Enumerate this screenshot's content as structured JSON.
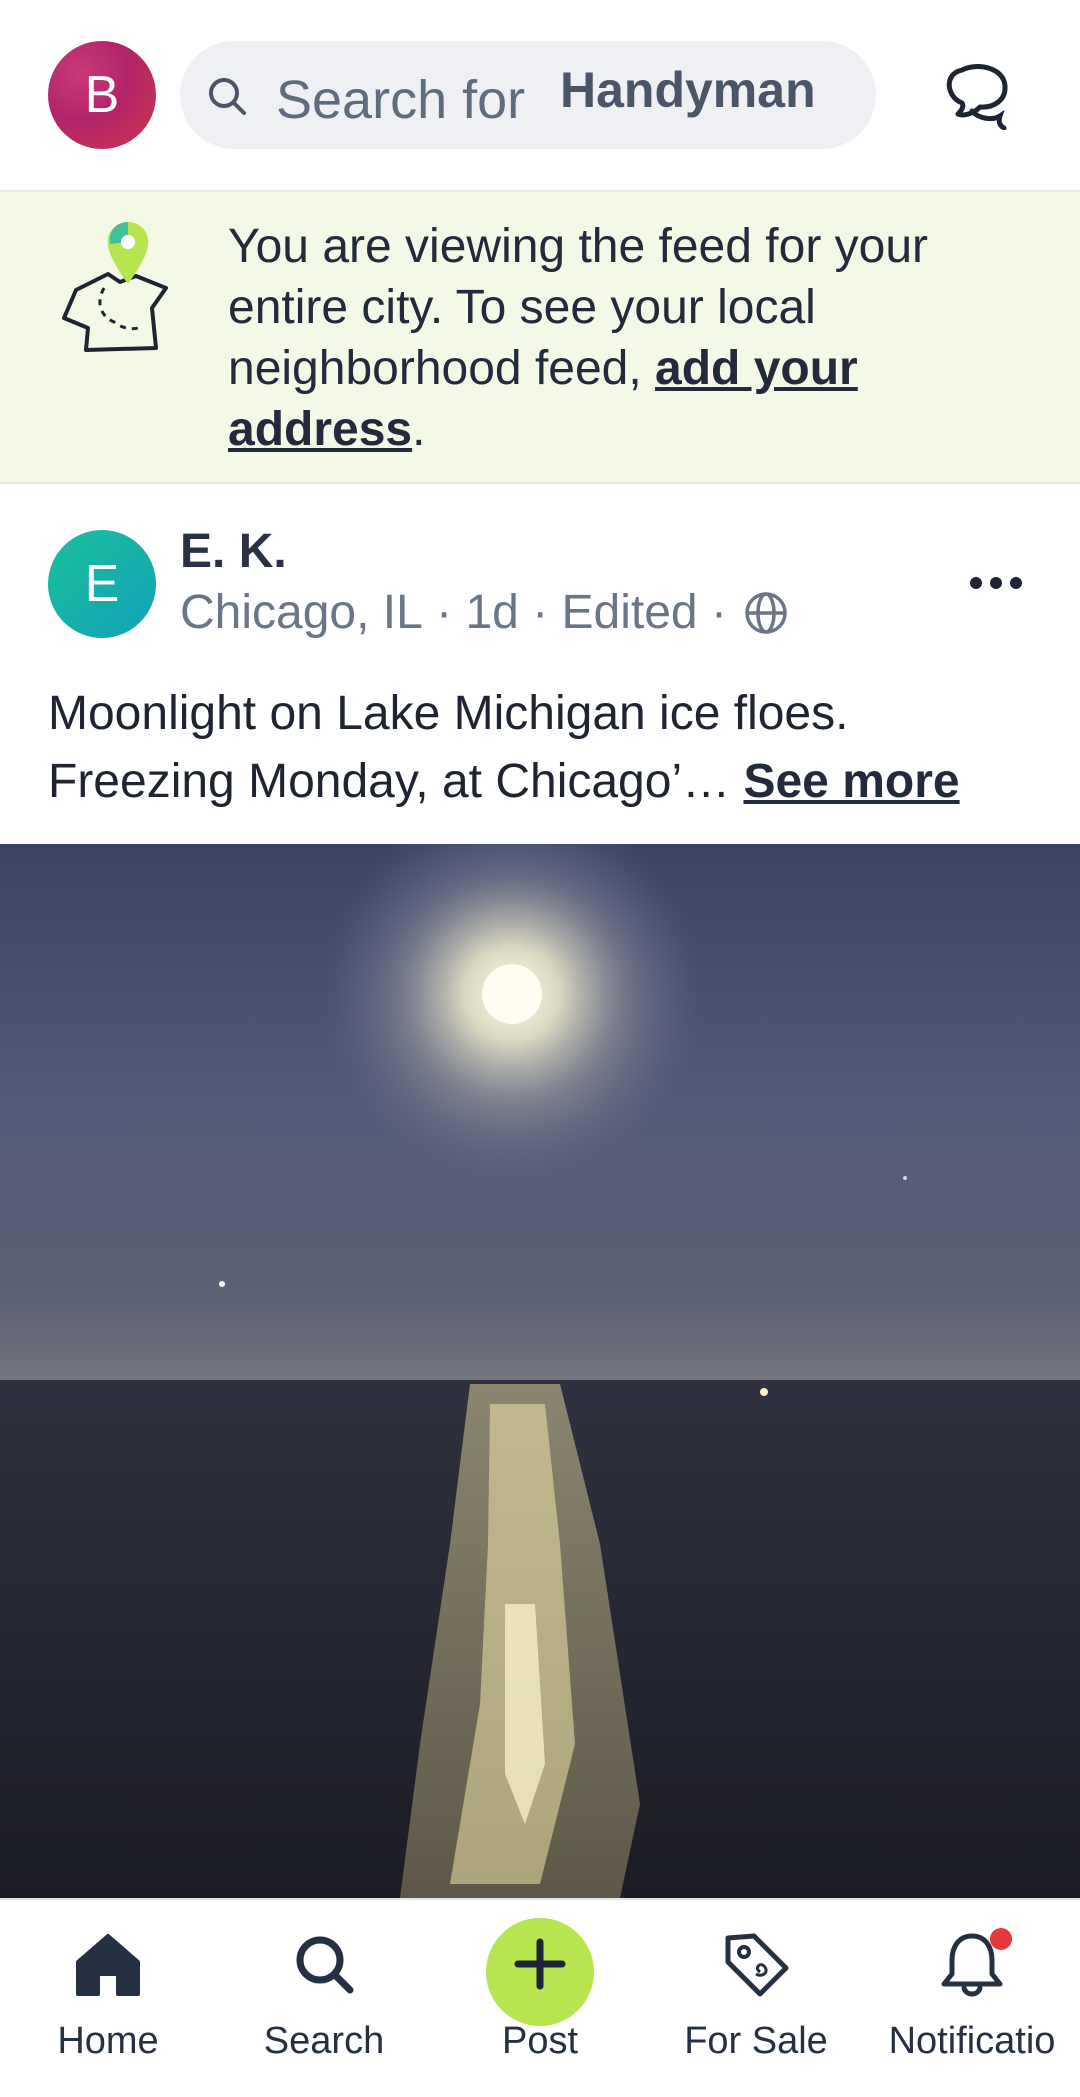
{
  "header": {
    "avatar_letter": "B",
    "search": {
      "placeholder": "Search for",
      "suggestion": "Handyman"
    }
  },
  "banner": {
    "text_before": "You are viewing the feed for your entire city. To see your local neighborhood feed, ",
    "link_text": "add your address",
    "text_after": "."
  },
  "post": {
    "avatar_letter": "E",
    "author": "E. K.",
    "location": "Chicago, IL",
    "time": "1d",
    "edited": "Edited",
    "body": "Moonlight on Lake Michigan ice floes. Freezing Monday, at Chicago’…",
    "see_more": "See more"
  },
  "bottom_nav": {
    "home": "Home",
    "search": "Search",
    "post": "Post",
    "for_sale": "For Sale",
    "notifications": "Notificatio"
  },
  "colors": {
    "accent_green": "#b6e54f",
    "banner_bg": "#f3f9e6",
    "notification_dot": "#e5383b"
  }
}
